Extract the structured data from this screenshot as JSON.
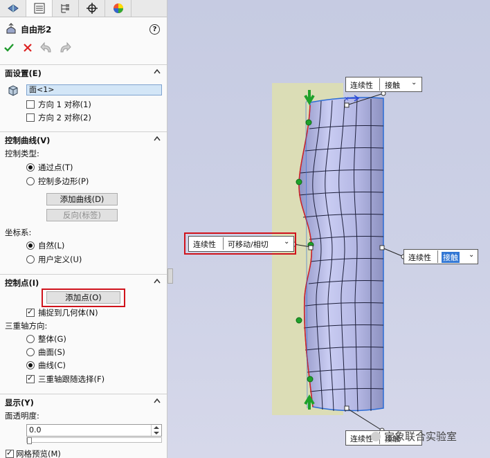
{
  "tabs": [
    "feature-manager",
    "property-manager",
    "configuration-manager",
    "dimxpert-manager",
    "display-manager"
  ],
  "title": "自由形2",
  "help": "?",
  "face_section": {
    "header": "面设置(E)",
    "face_value": "面<1>",
    "dir1": "方向 1 对称(1)",
    "dir2": "方向 2 对称(2)"
  },
  "curve_section": {
    "header": "控制曲线(V)",
    "type_label": "控制类型:",
    "opt1": "通过点(T)",
    "opt2": "控制多边形(P)",
    "add_curve": "添加曲线(D)",
    "reverse": "反向(标签)",
    "coord_label": "坐标系:",
    "coord1": "自然(L)",
    "coord2": "用户定义(U)"
  },
  "point_section": {
    "header": "控制点(I)",
    "add_point": "添加点(O)",
    "snap": "捕捉到几何体(N)",
    "triad_label": "三重轴方向:",
    "triad1": "整体(G)",
    "triad2": "曲面(S)",
    "triad3": "曲线(C)",
    "triad_follow": "三重轴跟随选择(F)"
  },
  "display_section": {
    "header": "显示(Y)",
    "transparency_label": "面透明度:",
    "transparency_value": "0.0",
    "mesh_preview": "网格预览(M)"
  },
  "viewport": {
    "top_cont": {
      "label": "连续性",
      "value": "接触"
    },
    "left_cont": {
      "label": "连续性",
      "value": "可移动/相切"
    },
    "right_cont": {
      "label": "连续性",
      "value": "接触"
    },
    "bottom_cont": {
      "label": "连续性",
      "value": "接触"
    },
    "watermark": "宝象联合实验室"
  },
  "colors": {
    "accent_red": "#d0121b",
    "surface": "#bfc3ea",
    "selection": "#d3e6f7",
    "control_point": "#1fa12a"
  }
}
